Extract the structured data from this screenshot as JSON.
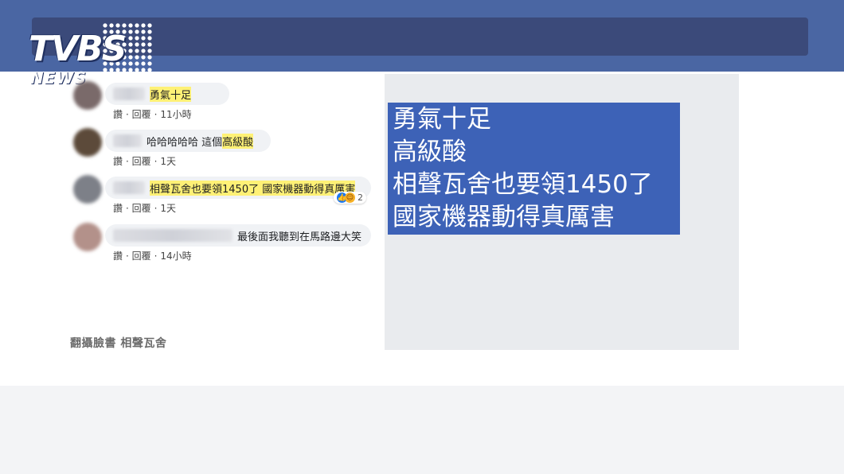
{
  "logo": {
    "main": "TVBS",
    "sub": "NEWS"
  },
  "comments": [
    {
      "text": "",
      "highlight": "勇氣十足",
      "like_label": "讚",
      "reply_label": "回覆",
      "time": "11小時",
      "avatar_color": "#7a6a6a"
    },
    {
      "text": "哈哈哈哈哈 這個",
      "highlight": "高級酸",
      "like_label": "讚",
      "reply_label": "回覆",
      "time": "1天",
      "avatar_color": "#5c4a3a"
    },
    {
      "text": "",
      "highlight": "相聲瓦舍也要領1450了 國家機器動得真厲害",
      "like_label": "讚",
      "reply_label": "回覆",
      "time": "1天",
      "avatar_color": "#7d8088",
      "reaction_count": "2"
    },
    {
      "text": "最後面我聽到在馬路邊大笑",
      "highlight": "",
      "like_label": "讚",
      "reply_label": "回覆",
      "time": "14小時",
      "avatar_color": "#b3918a"
    }
  ],
  "caption": "翻攝臉書  相聲瓦舍",
  "overlay_lines": [
    "勇氣十足",
    "高級酸",
    "相聲瓦舍也要領1450了",
    "國家機器動得真厲害"
  ],
  "colors": {
    "header": "#4a66a3",
    "overlay": "#3d62b7",
    "highlight": "#fff176"
  }
}
